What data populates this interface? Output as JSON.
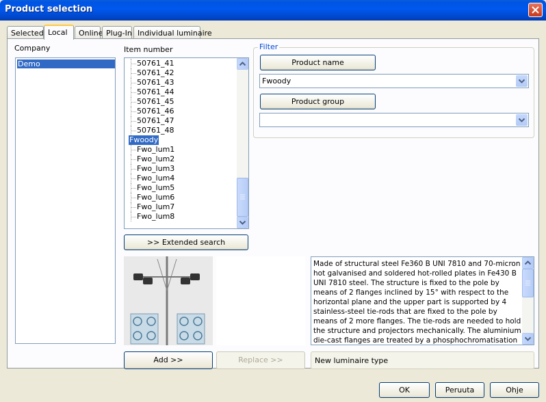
{
  "window": {
    "title": "Product selection"
  },
  "tabs": [
    {
      "label": "Selected",
      "active": false
    },
    {
      "label": "Local",
      "active": true
    },
    {
      "label": "Online",
      "active": false
    },
    {
      "label": "Plug-In",
      "active": false
    },
    {
      "label": "Individual luminaire",
      "active": false
    }
  ],
  "company": {
    "label": "Company",
    "items": [
      "Demo"
    ],
    "selected": "Demo"
  },
  "item_number": {
    "label": "Item number",
    "items": [
      {
        "text": "50761_41",
        "level": 1
      },
      {
        "text": "50761_42",
        "level": 1
      },
      {
        "text": "50761_43",
        "level": 1
      },
      {
        "text": "50761_44",
        "level": 1
      },
      {
        "text": "50761_45",
        "level": 1
      },
      {
        "text": "50761_46",
        "level": 1
      },
      {
        "text": "50761_47",
        "level": 1
      },
      {
        "text": "50761_48",
        "level": 1
      },
      {
        "text": "Fwoody",
        "level": 0,
        "selected": true
      },
      {
        "text": "Fwo_lum1",
        "level": 1
      },
      {
        "text": "Fwo_lum2",
        "level": 1
      },
      {
        "text": "Fwo_lum3",
        "level": 1
      },
      {
        "text": "Fwo_lum4",
        "level": 1
      },
      {
        "text": "Fwo_lum5",
        "level": 1
      },
      {
        "text": "Fwo_lum6",
        "level": 1
      },
      {
        "text": "Fwo_lum7",
        "level": 1
      },
      {
        "text": "Fwo_lum8",
        "level": 1
      }
    ]
  },
  "extended_search_label": ">> Extended search",
  "filter": {
    "legend": "Filter",
    "product_name_button": "Product name",
    "product_name_value": "Fwoody",
    "product_group_button": "Product group",
    "product_group_value": ""
  },
  "description": "Made of structural steel Fe360 B UNI 7810 and 70-micron hot galvanised and soldered hot-rolled plates in Fe430 B UNI 7810 steel. The structure is fixed to the pole by means of 2 flanges inclined by 15° with respect to the horizontal plane and the upper part is supported by 4 stainless-steel tie-rods that are fixed to the pole by means of 2 more flanges. The tie-rods are needed to hold the structure and projectors mechanically. The aluminium die-cast flanges are treated by a phosphochromatisation process. No holes in the poles need to be made for fixing the",
  "add_label": "Add >>",
  "replace_label": "Replace >>",
  "luminaire_type": "New luminaire type",
  "ok_label": "OK",
  "cancel_label": "Peruuta",
  "help_label": "Ohje",
  "colors": {
    "selection": "#316ac5",
    "title_bar": "#0054e3"
  }
}
